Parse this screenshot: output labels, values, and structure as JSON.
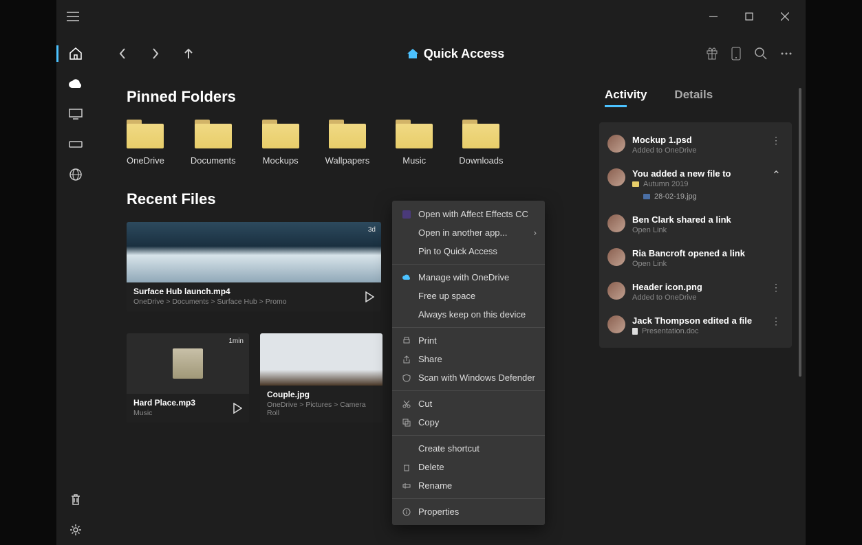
{
  "titlebar": {
    "minimize": "−",
    "maximize": "□",
    "close": "✕"
  },
  "toolbar": {
    "title": "Quick Access"
  },
  "sections": {
    "pinned": "Pinned Folders",
    "recent": "Recent Files"
  },
  "folders": [
    {
      "label": "OneDrive"
    },
    {
      "label": "Documents"
    },
    {
      "label": "Mockups"
    },
    {
      "label": "Wallpapers"
    },
    {
      "label": "Music"
    },
    {
      "label": "Downloads"
    }
  ],
  "recent": [
    {
      "name": "Surface Hub launch.mp4",
      "path": "OneDrive > Documents > Surface Hub > Promo",
      "duration": "3d"
    },
    {
      "name": "Hard Place.mp3",
      "path": "Music",
      "duration": "1min"
    },
    {
      "name": "Couple.jpg",
      "path": "OneDrive > Pictures > Camera Roll"
    }
  ],
  "tabs": {
    "activity": "Activity",
    "details": "Details"
  },
  "activity": [
    {
      "title": "Mockup 1.psd",
      "sub": "Added to OneDrive",
      "dots": true
    },
    {
      "title": "You added a new file to",
      "folder": "Autumn 2019",
      "file": "28-02-19.jpg",
      "chevron": true
    },
    {
      "title": "Ben Clark shared a link",
      "sub": "Open Link"
    },
    {
      "title": "Ria Bancroft opened a link",
      "sub": "Open Link"
    },
    {
      "title": "Header icon.png",
      "sub": "Added to OneDrive",
      "dots": true
    },
    {
      "title": "Jack Thompson edited a file",
      "doc": "Presentation.doc",
      "dots": true
    }
  ],
  "contextMenu": {
    "items": [
      {
        "label": "Open with Affect Effects CC",
        "icon": "ae"
      },
      {
        "label": "Open in another app...",
        "arrow": true
      },
      {
        "label": "Pin to Quick Access"
      },
      {
        "sep": true
      },
      {
        "label": "Manage with OneDrive",
        "icon": "cloud"
      },
      {
        "label": "Free up space"
      },
      {
        "label": "Always keep on this device"
      },
      {
        "sep": true
      },
      {
        "label": "Print",
        "icon": "print"
      },
      {
        "label": "Share",
        "icon": "share"
      },
      {
        "label": "Scan with Windows Defender",
        "icon": "shield"
      },
      {
        "sep": true
      },
      {
        "label": "Cut",
        "icon": "cut"
      },
      {
        "label": "Copy",
        "icon": "copy"
      },
      {
        "sep": true
      },
      {
        "label": "Create shortcut"
      },
      {
        "label": "Delete",
        "icon": "trash"
      },
      {
        "label": "Rename",
        "icon": "rename"
      },
      {
        "sep": true
      },
      {
        "label": "Properties",
        "icon": "info"
      }
    ]
  }
}
